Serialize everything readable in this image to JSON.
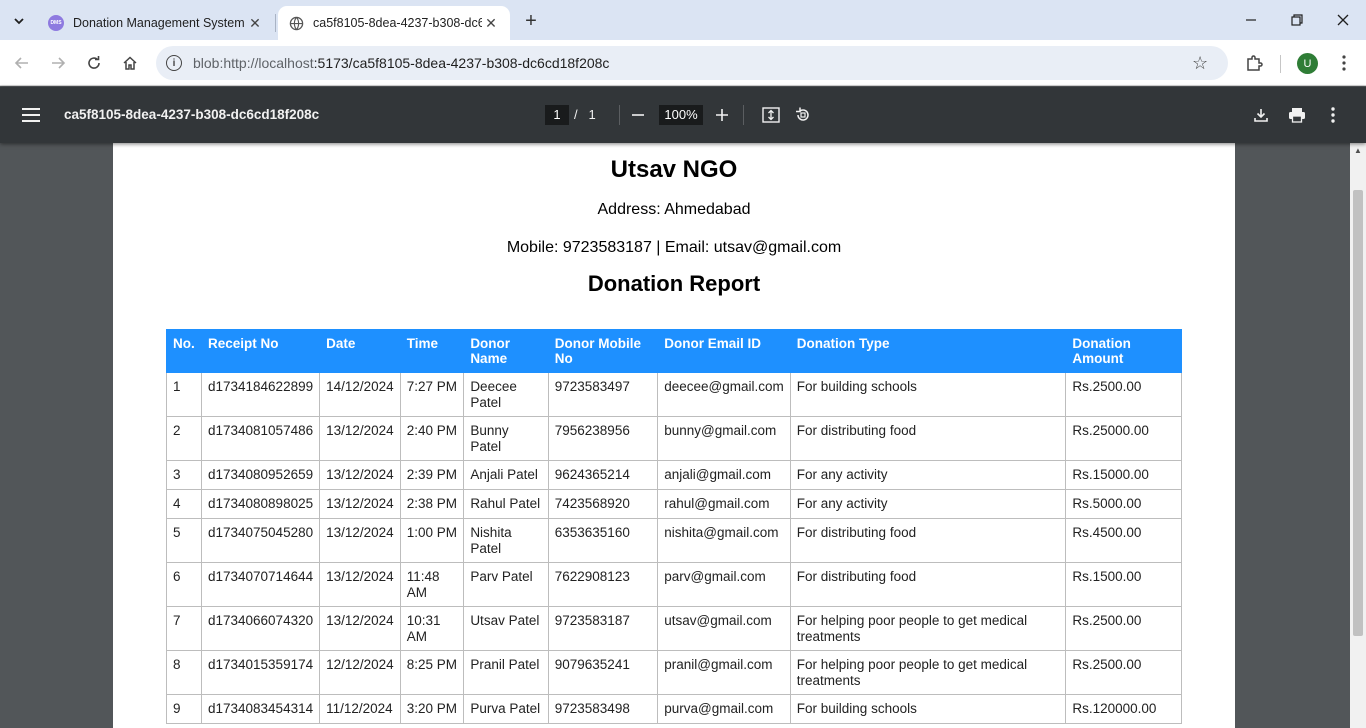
{
  "browser": {
    "tabs": [
      {
        "title": "Donation Management System",
        "favicon_text": "DMS",
        "active": false
      },
      {
        "title": "ca5f8105-8dea-4237-b308-dc6",
        "active": true
      }
    ],
    "url_host": "blob:http://localhost",
    "url_rest": ":5173/ca5f8105-8dea-4237-b308-dc6cd18f208c",
    "profile_initial": "U"
  },
  "pdf": {
    "doc_title": "ca5f8105-8dea-4237-b308-dc6cd18f208c",
    "current_page": "1",
    "page_sep": "/",
    "total_pages": "1",
    "zoom": "100%"
  },
  "report": {
    "org_name": "Utsav NGO",
    "address": "Address: Ahmedabad",
    "contact": "Mobile: 9723583187 | Email: utsav@gmail.com",
    "title": "Donation Report",
    "columns": [
      "No.",
      "Receipt No",
      "Date",
      "Time",
      "Donor Name",
      "Donor Mobile No",
      "Donor Email ID",
      "Donation Type",
      "Donation Amount"
    ],
    "rows": [
      [
        "1",
        "d1734184622899",
        "14/12/2024",
        "7:27 PM",
        "Deecee Patel",
        "9723583497",
        "deecee@gmail.com",
        "For building schools",
        "Rs.2500.00"
      ],
      [
        "2",
        "d1734081057486",
        "13/12/2024",
        "2:40 PM",
        "Bunny Patel",
        "7956238956",
        "bunny@gmail.com",
        "For distributing food",
        "Rs.25000.00"
      ],
      [
        "3",
        "d1734080952659",
        "13/12/2024",
        "2:39 PM",
        "Anjali Patel",
        "9624365214",
        "anjali@gmail.com",
        "For any activity",
        "Rs.15000.00"
      ],
      [
        "4",
        "d1734080898025",
        "13/12/2024",
        "2:38 PM",
        "Rahul Patel",
        "7423568920",
        "rahul@gmail.com",
        "For any activity",
        "Rs.5000.00"
      ],
      [
        "5",
        "d1734075045280",
        "13/12/2024",
        "1:00 PM",
        "Nishita Patel",
        "6353635160",
        "nishita@gmail.com",
        "For distributing food",
        "Rs.4500.00"
      ],
      [
        "6",
        "d1734070714644",
        "13/12/2024",
        "11:48 AM",
        "Parv Patel",
        "7622908123",
        "parv@gmail.com",
        "For distributing food",
        "Rs.1500.00"
      ],
      [
        "7",
        "d1734066074320",
        "13/12/2024",
        "10:31 AM",
        "Utsav Patel",
        "9723583187",
        "utsav@gmail.com",
        "For helping poor people to get medical treatments",
        "Rs.2500.00"
      ],
      [
        "8",
        "d1734015359174",
        "12/12/2024",
        "8:25 PM",
        "Pranil Patel",
        "9079635241",
        "pranil@gmail.com",
        "For helping poor people to get medical treatments",
        "Rs.2500.00"
      ],
      [
        "9",
        "d1734083454314",
        "11/12/2024",
        "3:20 PM",
        "Purva Patel",
        "9723583498",
        "purva@gmail.com",
        "For building schools",
        "Rs.120000.00"
      ]
    ]
  },
  "colors": {
    "table_header_bg": "#1e90ff",
    "pdf_toolbar_bg": "#323639",
    "tabstrip_bg": "#dbe4f3"
  }
}
